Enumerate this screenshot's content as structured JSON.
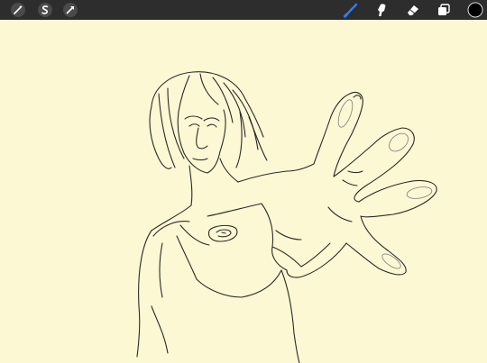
{
  "toolbar": {
    "left_tools": [
      {
        "name": "adjustments-wand-icon"
      },
      {
        "name": "selection-s-icon"
      },
      {
        "name": "transform-arrow-icon"
      }
    ],
    "right_tools": [
      {
        "name": "brush-icon",
        "active": true
      },
      {
        "name": "smudge-icon"
      },
      {
        "name": "eraser-icon"
      },
      {
        "name": "layers-icon"
      },
      {
        "name": "color-swatch",
        "color": "#000000"
      }
    ],
    "active_color": "#2f7bf5"
  },
  "canvas": {
    "background": "#fdf8d4",
    "content": "line-art-sketch"
  }
}
